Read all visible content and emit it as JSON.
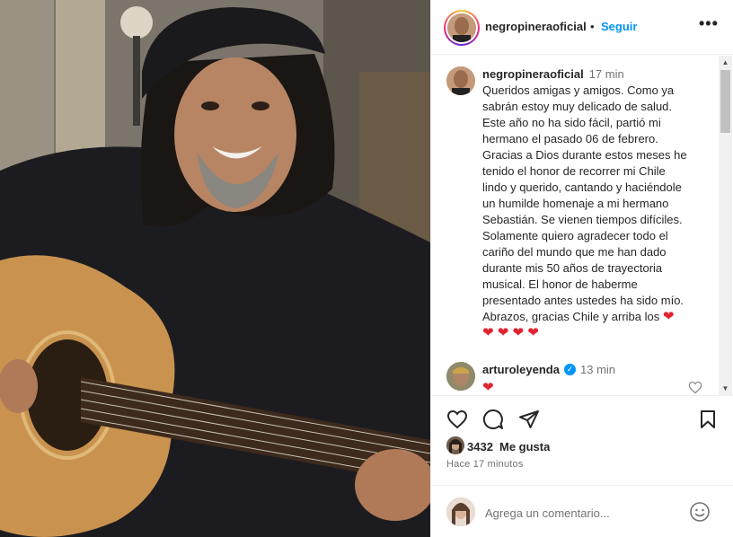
{
  "post": {
    "username": "negropineraoficial",
    "separator": "•",
    "follow_label": "Seguir",
    "more_icon": "more-options-icon",
    "caption_time": "17 min",
    "caption_lines": [
      "Queridos amigas y amigos. Como ya",
      "sabrán estoy muy delicado de salud.",
      "Este año no ha sido fácil, partió mi",
      "hermano el pasado 06 de febrero.",
      "Gracias a Dios durante estos meses he",
      "tenido el honor de recorrer mi Chile",
      "lindo y querido, cantando y haciéndole",
      "un humilde homenaje a mi hermano",
      "Sebastián. Se vienen tiempos difíciles.",
      "Solamente quiero agradecer todo el",
      "cariño del mundo que me han dado",
      "durante mis 50 años de trayectoria",
      "musical. El honor de haberme",
      "presentado antes ustedes ha sido mío.",
      "Abrazos, gracias Chile y arriba los"
    ],
    "caption_hearts_inline": "❤",
    "caption_hearts_row": "❤ ❤ ❤ ❤"
  },
  "comment": {
    "username": "arturoleyenda",
    "verified_badge": "✓",
    "time": "13 min",
    "text": "❤"
  },
  "actions": {
    "likes_count": "3432",
    "likes_label": "Me gusta",
    "posted_ago": "Hace 17 minutos"
  },
  "add_comment": {
    "placeholder": "Agrega un comentario..."
  },
  "colors": {
    "accent": "#0095f6",
    "heart": "#e0242f",
    "muted": "#737373"
  }
}
